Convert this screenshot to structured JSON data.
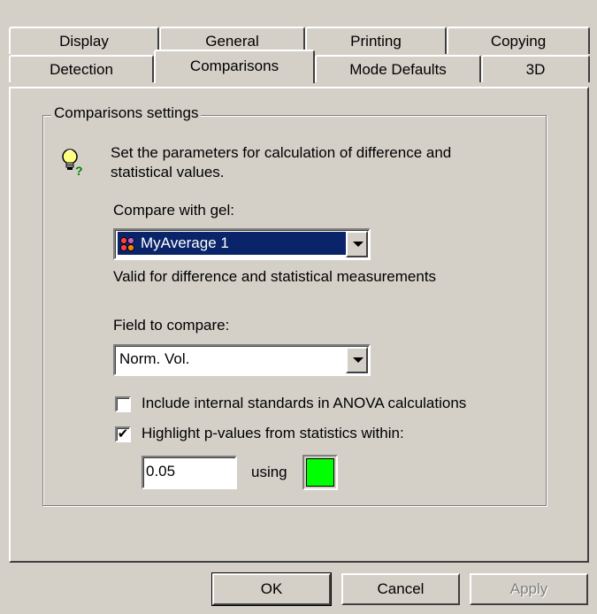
{
  "tabs_back_row": [
    {
      "label": "Display"
    },
    {
      "label": "General"
    },
    {
      "label": "Printing"
    },
    {
      "label": "Copying"
    }
  ],
  "tabs_front_row": [
    {
      "label": "Detection"
    },
    {
      "label": "Comparisons",
      "active": true
    },
    {
      "label": "Mode Defaults"
    },
    {
      "label": "3D"
    }
  ],
  "group": {
    "title": "Comparisons settings"
  },
  "description": {
    "line1": "Set the parameters for calculation of difference and",
    "line2": "statistical values.",
    "icon": "lightbulb-question-icon"
  },
  "compare_gel": {
    "label": "Compare with gel:",
    "value": "MyAverage 1",
    "icon": "gel-average-icon",
    "note": "Valid for difference and statistical measurements"
  },
  "field_compare": {
    "label": "Field to compare:",
    "value": "Norm. Vol."
  },
  "options": {
    "include_internal": {
      "label": "Include internal standards in ANOVA calculations",
      "checked": false
    },
    "highlight_pvalues": {
      "label": "Highlight p-values from statistics within:",
      "checked": true
    }
  },
  "pvalue": {
    "value": "0.05",
    "using_label": "using",
    "color": "#00ff00"
  },
  "buttons": {
    "ok": "OK",
    "cancel": "Cancel",
    "apply": "Apply"
  }
}
